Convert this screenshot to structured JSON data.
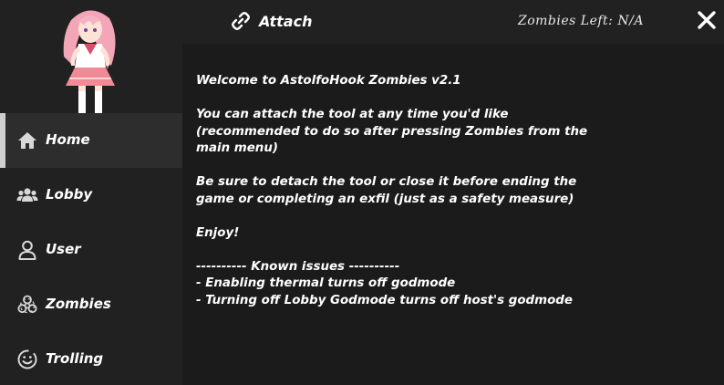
{
  "header": {
    "attach_label": "Attach",
    "zombies_left": "Zombies Left: N/A"
  },
  "sidebar": {
    "items": [
      {
        "label": "Home",
        "icon": "home-icon",
        "active": true
      },
      {
        "label": "Lobby",
        "icon": "users-icon",
        "active": false
      },
      {
        "label": "User",
        "icon": "user-icon",
        "active": false
      },
      {
        "label": "Zombies",
        "icon": "biohazard-icon",
        "active": false
      },
      {
        "label": "Trolling",
        "icon": "smile-icon",
        "active": false
      }
    ]
  },
  "content": {
    "welcome": "Welcome to AstolfoHook Zombies v2.1",
    "attach_info_1": "You can attach the tool at any time you'd like",
    "attach_info_2": "(recommended to do so after pressing Zombies from the",
    "attach_info_3": "main menu)",
    "detach_info_1": "Be sure to detach the tool or close it before ending the",
    "detach_info_2": "game or completing an exfil (just as a safety measure)",
    "enjoy": "Enjoy!",
    "issues_header": "---------- Known issues ----------",
    "issue_1": "- Enabling thermal turns off godmode",
    "issue_2": "- Turning off Lobby Godmode turns off host's godmode"
  },
  "colors": {
    "background": "#212121",
    "content_background": "#1b1b1b",
    "active_item": "#2d2d2d",
    "text": "#ffffff"
  }
}
